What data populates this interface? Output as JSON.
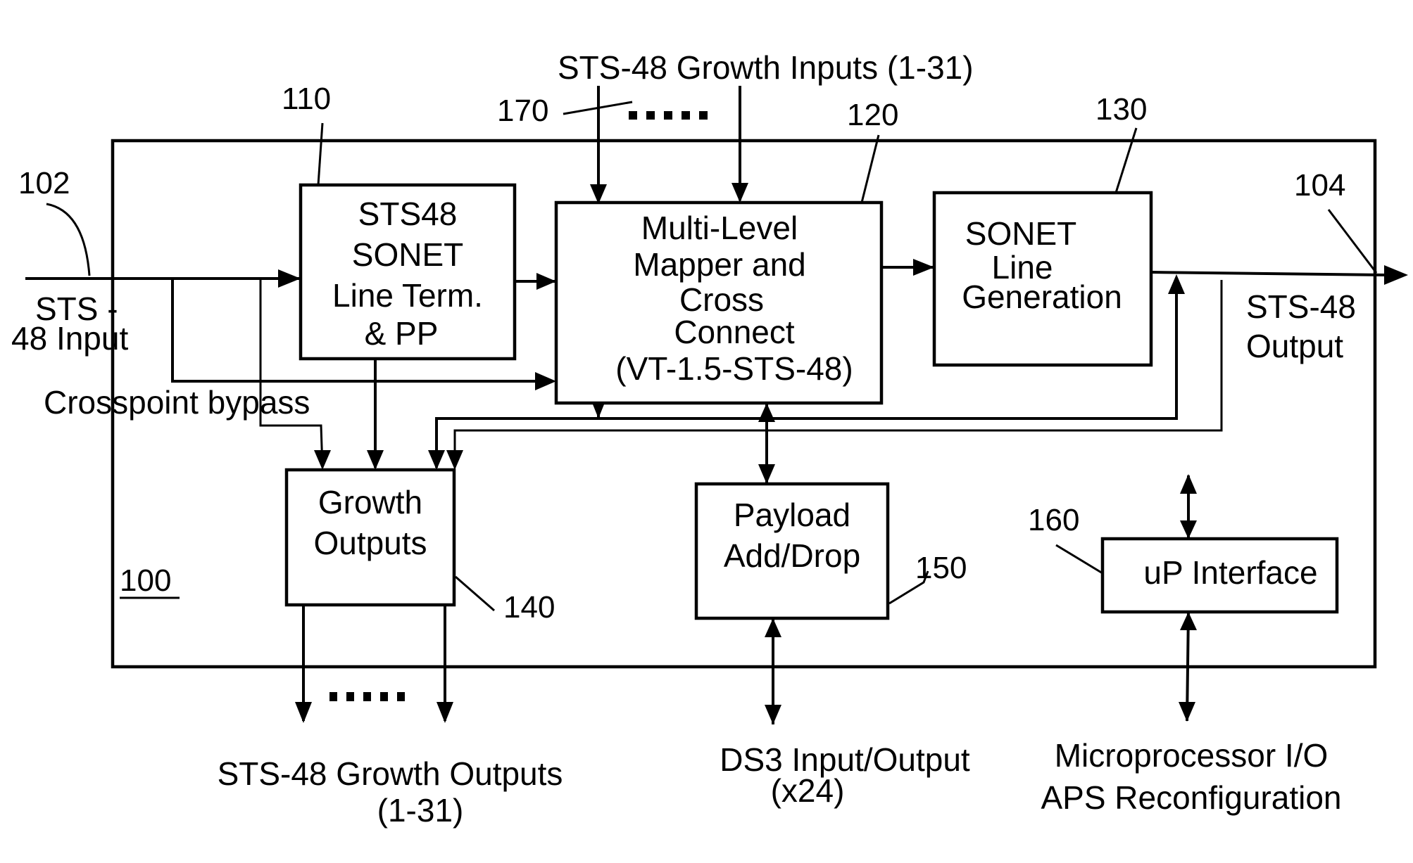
{
  "figure": {
    "reference_numerals": {
      "device": "100",
      "input": "102",
      "output": "104",
      "line_term": "110",
      "mapper": "120",
      "line_gen": "130",
      "growth_outputs": "140",
      "payload": "150",
      "up_interface": "160",
      "growth_inputs": "170"
    },
    "blocks": {
      "line_term": [
        "STS48",
        "SONET",
        "Line Term.",
        "& PP"
      ],
      "mapper": [
        "Multi-Level",
        "Mapper and",
        "Cross",
        "Connect",
        "(VT-1.5-STS-48)"
      ],
      "line_gen": [
        "SONET",
        "Line",
        "Generation"
      ],
      "growth_outputs": [
        "Growth",
        "Outputs"
      ],
      "payload": [
        "Payload",
        "Add/Drop"
      ],
      "up_interface": [
        "uP Interface"
      ]
    },
    "signals": {
      "growth_inputs": "STS-48 Growth Inputs (1-31)",
      "sts_input": [
        "STS -",
        "48 Input"
      ],
      "crosspoint_bypass": "Crosspoint bypass",
      "sts_output": [
        "STS-48",
        "Output"
      ],
      "growth_outputs": [
        "STS-48 Growth Outputs",
        "(1-31)"
      ],
      "ds3": [
        "DS3 Input/Output",
        "(x24)"
      ],
      "microprocessor": [
        "Microprocessor I/O",
        "APS Reconfiguration"
      ]
    }
  }
}
